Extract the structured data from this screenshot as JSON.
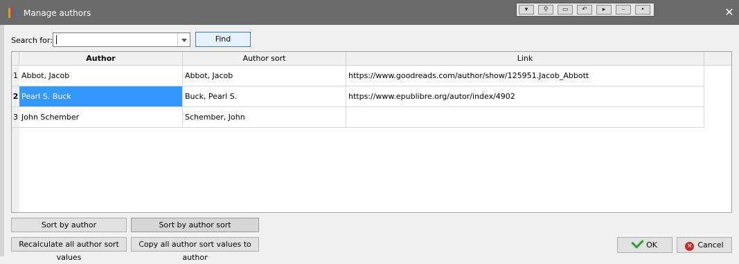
{
  "window": {
    "title": "Manage authors",
    "close_glyph": "✕"
  },
  "toolbar_icons": [
    "hide-icon",
    "pin-icon",
    "window-icon",
    "undo-icon",
    "record-icon",
    "minimize-icon",
    "dot-icon"
  ],
  "search": {
    "label": "Search for:",
    "value": "",
    "find_label": "Find"
  },
  "table": {
    "columns": [
      "Author",
      "Author sort",
      "Link"
    ],
    "rows": [
      {
        "num": "1",
        "author": "Abbot, Jacob",
        "author_sort": "Abbot, Jacob",
        "link": "https://www.goodreads.com/author/show/125951.Jacob_Abbott"
      },
      {
        "num": "2",
        "author": "Pearl S. Buck",
        "author_sort": "Buck, Pearl S.",
        "link": "https://www.epublibre.org/autor/index/4902"
      },
      {
        "num": "3",
        "author": "John Schember",
        "author_sort": "Schember, John",
        "link": ""
      }
    ],
    "selected_row": 1
  },
  "buttons": {
    "sort_by_author": "Sort by author",
    "sort_by_author_sort": "Sort by author sort",
    "recalculate": "Recalculate all author sort values",
    "copy_all": "Copy all author sort values to author",
    "ok": "OK",
    "cancel": "Cancel"
  },
  "colors": {
    "titlebar": "#6b6b6b",
    "selection": "#3399ff",
    "ok_check": "#2e9e2e",
    "cancel_icon": "#c62828"
  }
}
